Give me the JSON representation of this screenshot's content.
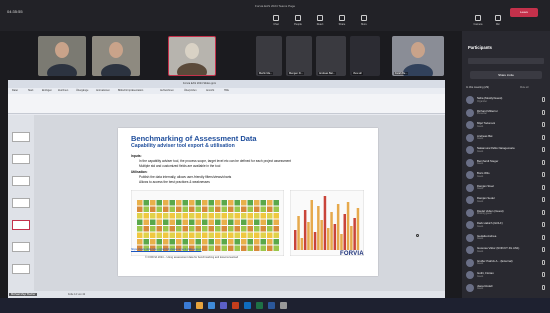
{
  "window": {
    "title": "Forvia EAS 2024 Teams Page",
    "timer": "04:35:55"
  },
  "toolbar": [
    {
      "label": "Chat"
    },
    {
      "label": "People"
    },
    {
      "label": "React"
    },
    {
      "label": "Share"
    },
    {
      "label": "More"
    },
    {
      "label": "Camera"
    },
    {
      "label": "Mic"
    },
    {
      "label": "Leave"
    }
  ],
  "video_tiles": [
    {
      "name": ""
    },
    {
      "name": ""
    },
    {
      "name": ""
    },
    {
      "name": "Merlin Ma..."
    },
    {
      "name": "Mengen Fr..."
    },
    {
      "name": "Andreas Bat..."
    },
    {
      "name": "View all"
    },
    {
      "name": "Farah Be..."
    }
  ],
  "ppt": {
    "filename": "Forvia EAS 2024 Slides.pptx",
    "menu": [
      "Datei",
      "Start",
      "Einfügen",
      "Zeichnen",
      "Übergänge",
      "Animationen",
      "Bildschirmpräsentation",
      "Aufzeichnen",
      "Überprüfen",
      "Ansicht",
      "Hilfe"
    ],
    "status": "Folie 14 von 42"
  },
  "slide": {
    "title": "Benchmarking of Assessment Data",
    "subtitle": "Capability adviser tool export & utilisation",
    "inputs_label": "Inputs:",
    "inputs": [
      "In the capability adviser tool, the process scope, target level etc can be defined for each project assessment",
      "Multiple std and customized fields are available in the tool"
    ],
    "utilisation_label": "Utilisation:",
    "utilisation": [
      "Publish the data internally, allows user-friendly filters/views/charts",
      "Allows to access the best practices & weaknesses"
    ],
    "url": "https://www.sliderule.org/activity/assessment-data-export",
    "copyright": "© FORVIA 2024 – Using assessment data for benchmarking and lessons learned",
    "logo": "FORVIA"
  },
  "participants": {
    "title": "Participants",
    "share_invite": "Share invite",
    "in_meeting": "In this meeting (29)",
    "mute_all": "Mute all",
    "people": [
      {
        "name": "Nidia (Mostly/Guest)",
        "role": "Organizer"
      },
      {
        "name": "Richard Mitterrer",
        "role": "Presenter"
      },
      {
        "name": "Mijel Todorová",
        "role": "Guest"
      },
      {
        "name": "Andreas Bat",
        "role": "Guest"
      },
      {
        "name": "Nakamura Pablo Naragemarie",
        "role": "Guest"
      },
      {
        "name": "Bernhardt Steger",
        "role": "Guest"
      },
      {
        "name": "Boris Wilo",
        "role": "Guest"
      },
      {
        "name": "Damjan Stoel",
        "role": "Guest"
      },
      {
        "name": "Damjan Sedel",
        "role": "Guest"
      },
      {
        "name": "Diedel Velten (Guest)",
        "role": "Working guest"
      },
      {
        "name": "Dark Habich (GOLF)",
        "role": "Guest"
      },
      {
        "name": "Gedalia Andrea",
        "role": "Guest"
      },
      {
        "name": "Gorensa Viktor (NOK/CT 4G AN1)",
        "role": "Guest"
      },
      {
        "name": "Grufler Patrick A... (External)",
        "role": "Guest"
      },
      {
        "name": "Guthi, Florian",
        "role": "Guest"
      },
      {
        "name": "Jiana Rodell",
        "role": "Guest"
      }
    ]
  },
  "speaker": "Michael Mayr Bucher",
  "colors": {
    "accent": "#c4314b",
    "slide_title": "#1f4e9c",
    "logo": "#1a2f78"
  }
}
